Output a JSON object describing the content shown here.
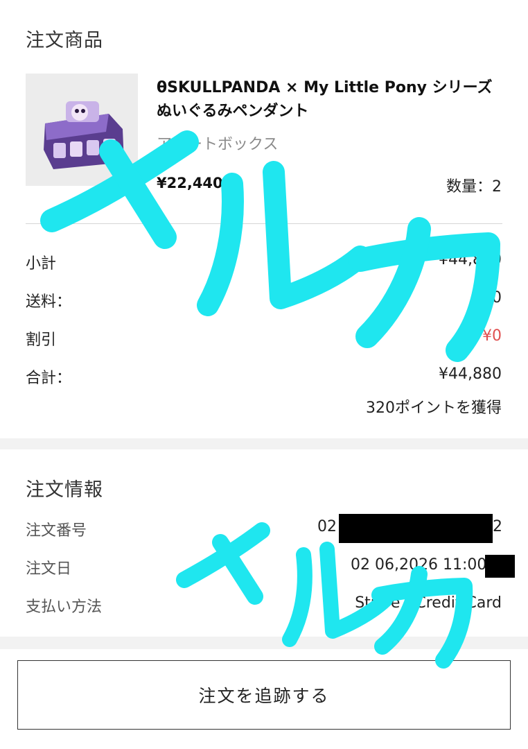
{
  "order_items": {
    "title": "注文商品",
    "product": {
      "name": "θSKULLPANDA × My Little Pony シリーズ ぬいぐるみペンダント",
      "variant": "アソートボックス",
      "price": "¥22,440",
      "quantity_label": "数量：",
      "quantity_value": "2"
    }
  },
  "summary": {
    "subtotal_label": "小計",
    "subtotal_value": "¥44,880",
    "shipping_label": "送料：",
    "shipping_value": "¥0",
    "discount_label": "割引",
    "discount_value": "¥0",
    "total_label": "合計：",
    "total_value": "¥44,880",
    "points": "320ポイントを獲得"
  },
  "order_info": {
    "title": "注文情報",
    "order_number_label": "注文番号",
    "order_number_prefix": "02",
    "order_number_suffix": "2",
    "order_date_label": "注文日",
    "order_date_value": "02 06,2026 11:00:",
    "payment_label": "支払い方法",
    "payment_value": "Stripe - Credit Card"
  },
  "actions": {
    "track_label": "注文を追跡する"
  },
  "watermark": {
    "text": "メルカ",
    "color": "#1fe6ef"
  },
  "colors": {
    "discount": "#e05050",
    "band": "#f2f2f2"
  }
}
